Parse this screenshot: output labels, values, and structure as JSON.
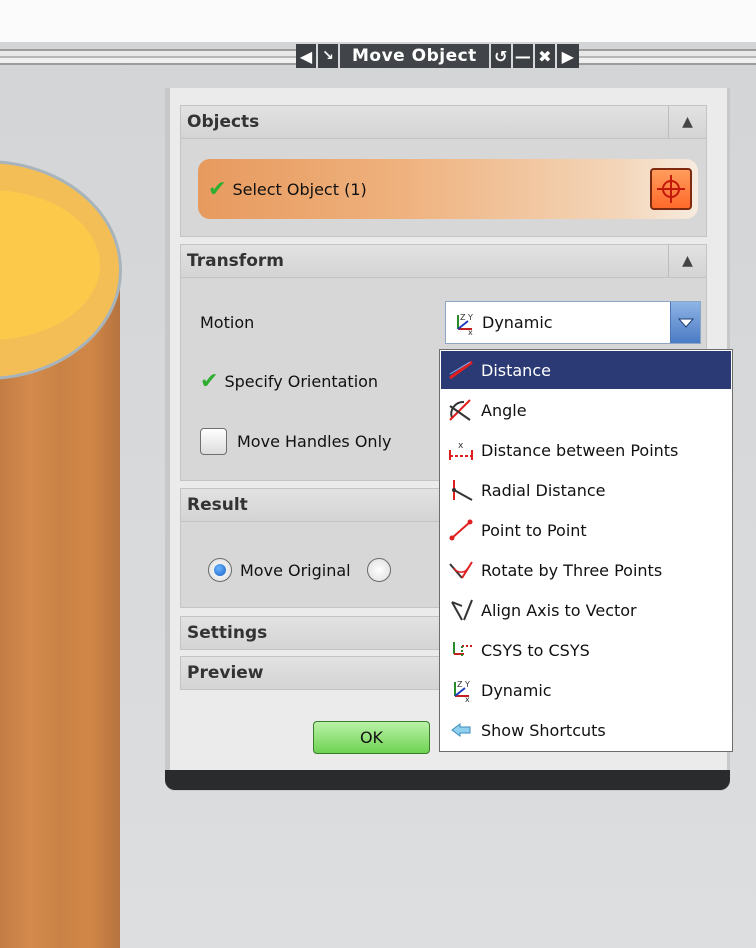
{
  "dialog": {
    "title": "Move Object",
    "sections": {
      "objects": {
        "heading": "Objects",
        "select_label": "Select Object (1)"
      },
      "transform": {
        "heading": "Transform",
        "motion_label": "Motion",
        "motion_value": "Dynamic",
        "specify_orientation": "Specify Orientation",
        "move_handles_only": "Move Handles Only"
      },
      "result": {
        "heading": "Result",
        "move_original": "Move Original"
      },
      "settings": {
        "heading": "Settings"
      },
      "preview": {
        "heading": "Preview"
      }
    },
    "ok_label": "OK"
  },
  "motion_menu": {
    "items": [
      {
        "label": "Distance",
        "icon": "distance-icon",
        "selected": true
      },
      {
        "label": "Angle",
        "icon": "angle-icon"
      },
      {
        "label": "Distance between Points",
        "icon": "distance-between-points-icon"
      },
      {
        "label": "Radial Distance",
        "icon": "radial-distance-icon"
      },
      {
        "label": "Point to Point",
        "icon": "point-to-point-icon"
      },
      {
        "label": "Rotate by Three Points",
        "icon": "rotate-three-points-icon"
      },
      {
        "label": "Align Axis to Vector",
        "icon": "align-axis-icon"
      },
      {
        "label": "CSYS to CSYS",
        "icon": "csys-icon"
      },
      {
        "label": "Dynamic",
        "icon": "dynamic-csys-icon"
      },
      {
        "label": "Show Shortcuts",
        "icon": "show-shortcuts-icon"
      }
    ]
  },
  "colors": {
    "title_bar": "#41454a",
    "selected_item": "#2b3a74",
    "select_row": "#efb17d",
    "ok_button": "#6ed253",
    "cylinder": "#d48a4d"
  }
}
